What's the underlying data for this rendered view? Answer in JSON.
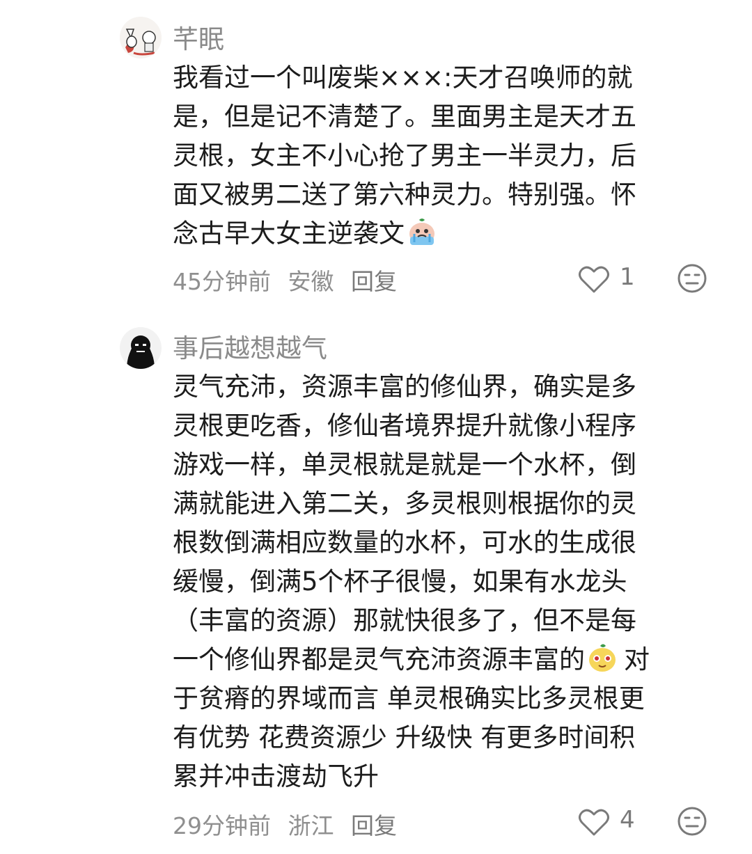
{
  "comments": [
    {
      "username": "芊眠",
      "lines": [
        "我看过一个叫废柴×××:天才召唤师的就",
        "是，但是记不清楚了。里面男主是天才五",
        "灵根，女主不小心抢了男主一半灵力，后",
        "面又被男二送了第六种灵力。特别强。怀",
        "念古早大女主逆袭文"
      ],
      "time": "45分钟前",
      "location": "安徽",
      "reply_label": "回复",
      "likes": "1"
    },
    {
      "username": "事后越想越气",
      "lines": [
        "灵气充沛，资源丰富的修仙界，确实是多",
        "灵根更吃香，修仙者境界提升就像小程序",
        "游戏一样，单灵根就是就是一个水杯，倒",
        "满就能进入第二关，多灵根则根据你的灵",
        "根数倒满相应数量的水杯，可水的生成很",
        "缓慢，倒满5个杯子很慢，如果有水龙头",
        "（丰富的资源）那就快很多了，但不是每",
        "一个修仙界都是灵气充沛资源丰富的",
        "于贫瘠的界域而言 单灵根确实比多灵根更",
        "有优势 花费资源少 升级快 有更多时间积",
        "累并冲击渡劫飞升"
      ],
      "line8_after_emoji": "对",
      "time": "29分钟前",
      "location": "浙江",
      "reply_label": "回复",
      "likes": "4"
    }
  ],
  "icons": {
    "like": "heart-outline-icon",
    "dislike": "unhappy-face-icon",
    "emoji1": "crying-face-emoji",
    "emoji2": "cute-face-emoji"
  },
  "colors": {
    "username": "#8a8a8a",
    "meta": "#8f8f8f",
    "text": "#1c1c1c"
  }
}
